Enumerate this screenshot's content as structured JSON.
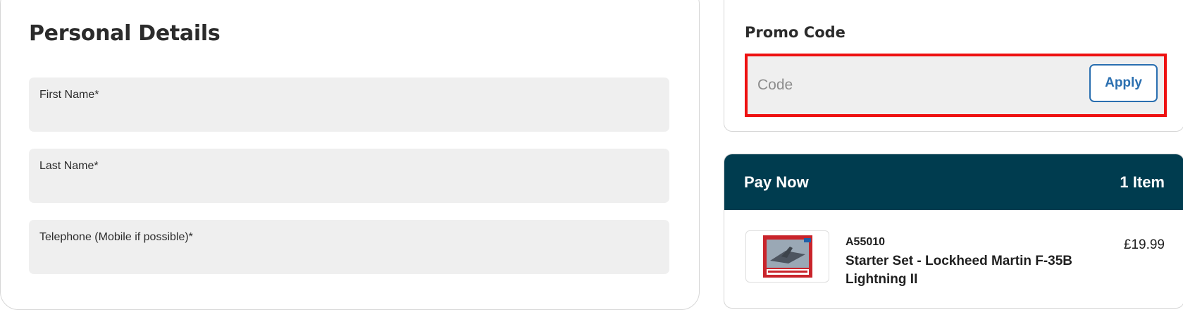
{
  "personal_details": {
    "title": "Personal Details",
    "fields": [
      {
        "label": "First Name*",
        "value": ""
      },
      {
        "label": "Last Name*",
        "value": ""
      },
      {
        "label": "Telephone (Mobile if possible)*",
        "value": ""
      }
    ]
  },
  "promo": {
    "title": "Promo Code",
    "placeholder": "Code",
    "value": "",
    "apply_label": "Apply",
    "highlight_color": "#ee1111"
  },
  "pay_now": {
    "title": "Pay Now",
    "item_count": "1 Item",
    "header_color": "#003c4f",
    "items": [
      {
        "sku": "A55010",
        "name": "Starter Set - Lockheed Martin F-35B Lightning II",
        "price": "£19.99",
        "thumbnail_icon": "product-box-image"
      }
    ]
  },
  "colors": {
    "accent": "#2a6fb0",
    "field_bg": "#efefef"
  }
}
